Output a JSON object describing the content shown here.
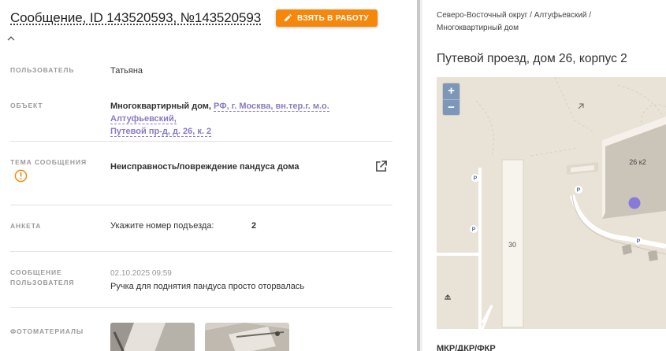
{
  "header": {
    "title": "Сообщение, ID 143520593, №143520593",
    "take_button": "ВЗЯТЬ В РАБОТУ"
  },
  "fields": {
    "user": {
      "label": "ПОЛЬЗОВАТЕЛЬ",
      "value": "Татьяна"
    },
    "object": {
      "label": "ОБЪЕКТ",
      "type": "Многоквартирный дом, ",
      "link_line1": "РФ, г. Москва, вн.тер.г. м.о. Алтуфьевский,",
      "link_line2": "Путевой пр-д, д. 26, к. 2"
    },
    "topic": {
      "label": "ТЕМА СООБЩЕНИЯ",
      "value": "Неисправность/повреждение пандуса дома"
    },
    "survey": {
      "label": "АНКЕТА",
      "question": "Укажите номер подъезда:",
      "answer": "2"
    },
    "message": {
      "label_line1": "СООБЩЕНИЕ",
      "label_line2": "ПОЛЬЗОВАТЕЛЯ",
      "date": "02.10.2025 09:59",
      "text": "Ручка для поднятия пандуса просто оторвалась"
    },
    "photos": {
      "label": "ФОТОМАТЕРИАЛЫ"
    }
  },
  "right": {
    "breadcrumb_line1": "Северо-Восточный округ / Алтуфьевский /",
    "breadcrumb_line2": "Многоквартирный дом",
    "address": "Путевой проезд, дом 26, корпус 2",
    "bottom_label": "МКР/ДКР/ФКР"
  },
  "map": {
    "zoom_in": "+",
    "zoom_out": "−",
    "building_label": "26 к2",
    "road_label": "30",
    "parking": "P"
  },
  "colors": {
    "accent_orange": "#f5880b",
    "link_purple": "#8a7ac6",
    "marker": "#8a7ad8"
  }
}
